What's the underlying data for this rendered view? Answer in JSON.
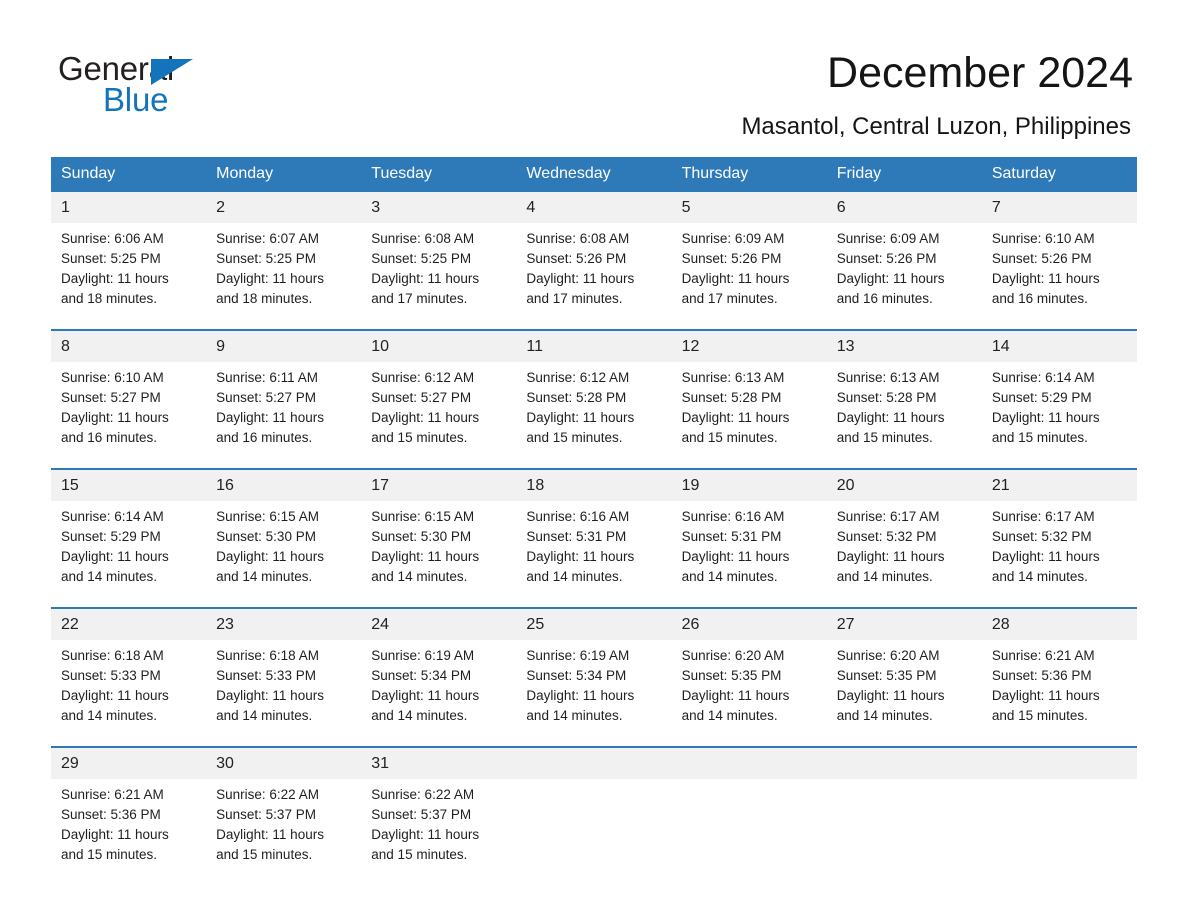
{
  "brand": {
    "name_part1": "General",
    "name_part2": "Blue",
    "accent_color": "#1474bb"
  },
  "header": {
    "title": "December 2024",
    "subtitle": "Masantol, Central Luzon, Philippines"
  },
  "calendar": {
    "header_bg": "#2e7ab9",
    "daynum_bg": "#f1f1f1",
    "weekday_headers": [
      "Sunday",
      "Monday",
      "Tuesday",
      "Wednesday",
      "Thursday",
      "Friday",
      "Saturday"
    ],
    "weeks": [
      {
        "days": [
          {
            "num": "1",
            "sunrise": "Sunrise: 6:06 AM",
            "sunset": "Sunset: 5:25 PM",
            "daylight1": "Daylight: 11 hours",
            "daylight2": "and 18 minutes."
          },
          {
            "num": "2",
            "sunrise": "Sunrise: 6:07 AM",
            "sunset": "Sunset: 5:25 PM",
            "daylight1": "Daylight: 11 hours",
            "daylight2": "and 18 minutes."
          },
          {
            "num": "3",
            "sunrise": "Sunrise: 6:08 AM",
            "sunset": "Sunset: 5:25 PM",
            "daylight1": "Daylight: 11 hours",
            "daylight2": "and 17 minutes."
          },
          {
            "num": "4",
            "sunrise": "Sunrise: 6:08 AM",
            "sunset": "Sunset: 5:26 PM",
            "daylight1": "Daylight: 11 hours",
            "daylight2": "and 17 minutes."
          },
          {
            "num": "5",
            "sunrise": "Sunrise: 6:09 AM",
            "sunset": "Sunset: 5:26 PM",
            "daylight1": "Daylight: 11 hours",
            "daylight2": "and 17 minutes."
          },
          {
            "num": "6",
            "sunrise": "Sunrise: 6:09 AM",
            "sunset": "Sunset: 5:26 PM",
            "daylight1": "Daylight: 11 hours",
            "daylight2": "and 16 minutes."
          },
          {
            "num": "7",
            "sunrise": "Sunrise: 6:10 AM",
            "sunset": "Sunset: 5:26 PM",
            "daylight1": "Daylight: 11 hours",
            "daylight2": "and 16 minutes."
          }
        ]
      },
      {
        "days": [
          {
            "num": "8",
            "sunrise": "Sunrise: 6:10 AM",
            "sunset": "Sunset: 5:27 PM",
            "daylight1": "Daylight: 11 hours",
            "daylight2": "and 16 minutes."
          },
          {
            "num": "9",
            "sunrise": "Sunrise: 6:11 AM",
            "sunset": "Sunset: 5:27 PM",
            "daylight1": "Daylight: 11 hours",
            "daylight2": "and 16 minutes."
          },
          {
            "num": "10",
            "sunrise": "Sunrise: 6:12 AM",
            "sunset": "Sunset: 5:27 PM",
            "daylight1": "Daylight: 11 hours",
            "daylight2": "and 15 minutes."
          },
          {
            "num": "11",
            "sunrise": "Sunrise: 6:12 AM",
            "sunset": "Sunset: 5:28 PM",
            "daylight1": "Daylight: 11 hours",
            "daylight2": "and 15 minutes."
          },
          {
            "num": "12",
            "sunrise": "Sunrise: 6:13 AM",
            "sunset": "Sunset: 5:28 PM",
            "daylight1": "Daylight: 11 hours",
            "daylight2": "and 15 minutes."
          },
          {
            "num": "13",
            "sunrise": "Sunrise: 6:13 AM",
            "sunset": "Sunset: 5:28 PM",
            "daylight1": "Daylight: 11 hours",
            "daylight2": "and 15 minutes."
          },
          {
            "num": "14",
            "sunrise": "Sunrise: 6:14 AM",
            "sunset": "Sunset: 5:29 PM",
            "daylight1": "Daylight: 11 hours",
            "daylight2": "and 15 minutes."
          }
        ]
      },
      {
        "days": [
          {
            "num": "15",
            "sunrise": "Sunrise: 6:14 AM",
            "sunset": "Sunset: 5:29 PM",
            "daylight1": "Daylight: 11 hours",
            "daylight2": "and 14 minutes."
          },
          {
            "num": "16",
            "sunrise": "Sunrise: 6:15 AM",
            "sunset": "Sunset: 5:30 PM",
            "daylight1": "Daylight: 11 hours",
            "daylight2": "and 14 minutes."
          },
          {
            "num": "17",
            "sunrise": "Sunrise: 6:15 AM",
            "sunset": "Sunset: 5:30 PM",
            "daylight1": "Daylight: 11 hours",
            "daylight2": "and 14 minutes."
          },
          {
            "num": "18",
            "sunrise": "Sunrise: 6:16 AM",
            "sunset": "Sunset: 5:31 PM",
            "daylight1": "Daylight: 11 hours",
            "daylight2": "and 14 minutes."
          },
          {
            "num": "19",
            "sunrise": "Sunrise: 6:16 AM",
            "sunset": "Sunset: 5:31 PM",
            "daylight1": "Daylight: 11 hours",
            "daylight2": "and 14 minutes."
          },
          {
            "num": "20",
            "sunrise": "Sunrise: 6:17 AM",
            "sunset": "Sunset: 5:32 PM",
            "daylight1": "Daylight: 11 hours",
            "daylight2": "and 14 minutes."
          },
          {
            "num": "21",
            "sunrise": "Sunrise: 6:17 AM",
            "sunset": "Sunset: 5:32 PM",
            "daylight1": "Daylight: 11 hours",
            "daylight2": "and 14 minutes."
          }
        ]
      },
      {
        "days": [
          {
            "num": "22",
            "sunrise": "Sunrise: 6:18 AM",
            "sunset": "Sunset: 5:33 PM",
            "daylight1": "Daylight: 11 hours",
            "daylight2": "and 14 minutes."
          },
          {
            "num": "23",
            "sunrise": "Sunrise: 6:18 AM",
            "sunset": "Sunset: 5:33 PM",
            "daylight1": "Daylight: 11 hours",
            "daylight2": "and 14 minutes."
          },
          {
            "num": "24",
            "sunrise": "Sunrise: 6:19 AM",
            "sunset": "Sunset: 5:34 PM",
            "daylight1": "Daylight: 11 hours",
            "daylight2": "and 14 minutes."
          },
          {
            "num": "25",
            "sunrise": "Sunrise: 6:19 AM",
            "sunset": "Sunset: 5:34 PM",
            "daylight1": "Daylight: 11 hours",
            "daylight2": "and 14 minutes."
          },
          {
            "num": "26",
            "sunrise": "Sunrise: 6:20 AM",
            "sunset": "Sunset: 5:35 PM",
            "daylight1": "Daylight: 11 hours",
            "daylight2": "and 14 minutes."
          },
          {
            "num": "27",
            "sunrise": "Sunrise: 6:20 AM",
            "sunset": "Sunset: 5:35 PM",
            "daylight1": "Daylight: 11 hours",
            "daylight2": "and 14 minutes."
          },
          {
            "num": "28",
            "sunrise": "Sunrise: 6:21 AM",
            "sunset": "Sunset: 5:36 PM",
            "daylight1": "Daylight: 11 hours",
            "daylight2": "and 15 minutes."
          }
        ]
      },
      {
        "days": [
          {
            "num": "29",
            "sunrise": "Sunrise: 6:21 AM",
            "sunset": "Sunset: 5:36 PM",
            "daylight1": "Daylight: 11 hours",
            "daylight2": "and 15 minutes."
          },
          {
            "num": "30",
            "sunrise": "Sunrise: 6:22 AM",
            "sunset": "Sunset: 5:37 PM",
            "daylight1": "Daylight: 11 hours",
            "daylight2": "and 15 minutes."
          },
          {
            "num": "31",
            "sunrise": "Sunrise: 6:22 AM",
            "sunset": "Sunset: 5:37 PM",
            "daylight1": "Daylight: 11 hours",
            "daylight2": "and 15 minutes."
          },
          {
            "num": "",
            "sunrise": "",
            "sunset": "",
            "daylight1": "",
            "daylight2": ""
          },
          {
            "num": "",
            "sunrise": "",
            "sunset": "",
            "daylight1": "",
            "daylight2": ""
          },
          {
            "num": "",
            "sunrise": "",
            "sunset": "",
            "daylight1": "",
            "daylight2": ""
          },
          {
            "num": "",
            "sunrise": "",
            "sunset": "",
            "daylight1": "",
            "daylight2": ""
          }
        ]
      }
    ]
  }
}
